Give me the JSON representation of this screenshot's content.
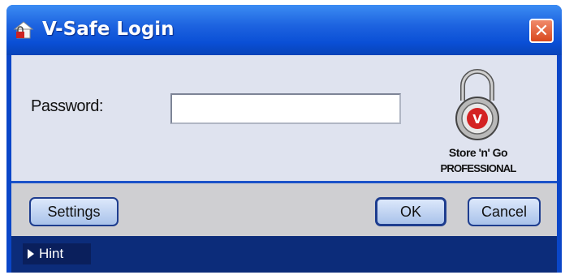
{
  "window": {
    "title": "V-Safe Login",
    "close_label": "✕",
    "icons": {
      "app": "lock-house-icon",
      "close": "close-icon"
    },
    "colors": {
      "titlebar": "#1e64e0",
      "frame": "#0a46c8",
      "close": "#d8481e"
    }
  },
  "form": {
    "password_label": "Password:",
    "password_value": "",
    "password_placeholder": ""
  },
  "brand": {
    "line1": "Store 'n' Go",
    "line2": "PROFESSIONAL",
    "logo_icon": "padlock-icon",
    "logo_letter": "V"
  },
  "buttons": {
    "settings": "Settings",
    "ok": "OK",
    "cancel": "Cancel"
  },
  "hint": {
    "label": "Hint",
    "icon": "triangle-right-icon"
  }
}
